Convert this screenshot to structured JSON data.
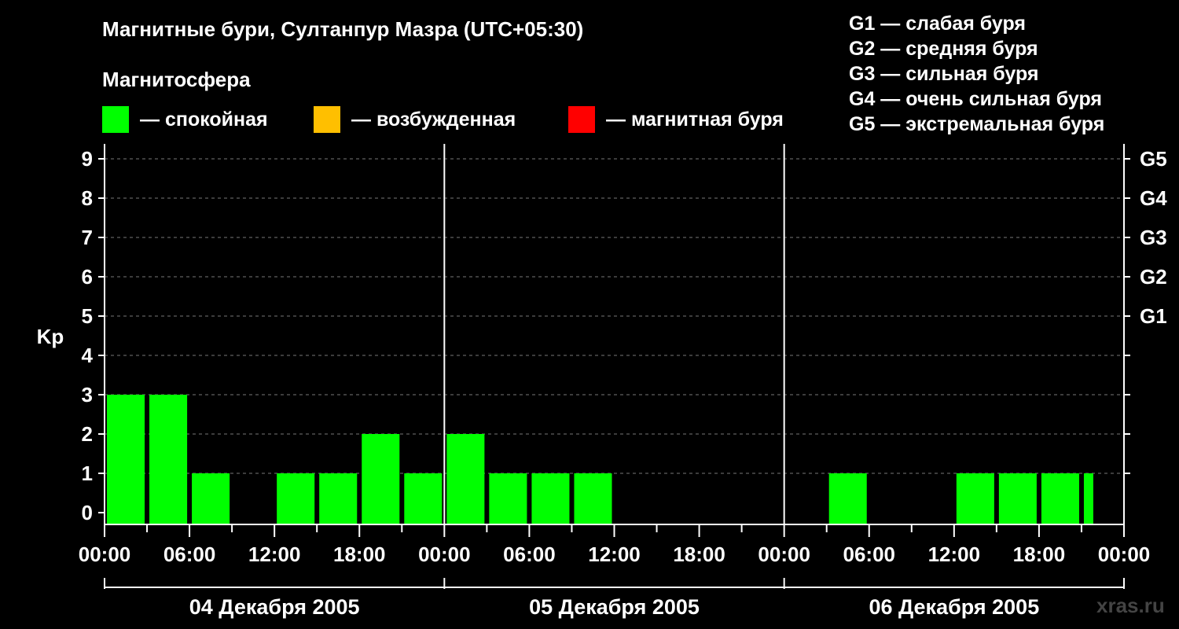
{
  "title": "Магнитные бури, Султанпур Мазра (UTC+05:30)",
  "subtitle": "Магнитосфера",
  "legend": [
    {
      "label": "— спокойная",
      "color": "#00ff00"
    },
    {
      "label": "— возбужденная",
      "color": "#ffbf00"
    },
    {
      "label": "— магнитная буря",
      "color": "#ff0000"
    }
  ],
  "g_scale": [
    "G1 — слабая буря",
    "G2 — средняя буря",
    "G3 — сильная буря",
    "G4 — очень сильная буря",
    "G5 — экстремальная буря"
  ],
  "watermark": "xras.ru",
  "chart_data": {
    "type": "bar",
    "ylabel": "Kp",
    "ylim": [
      0,
      9
    ],
    "y_ticks": [
      "0",
      "1",
      "2",
      "3",
      "4",
      "5",
      "6",
      "7",
      "8",
      "9"
    ],
    "right_ticks": [
      {
        "kp": 5,
        "label": "G1"
      },
      {
        "kp": 6,
        "label": "G2"
      },
      {
        "kp": 7,
        "label": "G3"
      },
      {
        "kp": 8,
        "label": "G4"
      },
      {
        "kp": 9,
        "label": "G5"
      }
    ],
    "x_tick_labels": [
      "00:00",
      "06:00",
      "12:00",
      "18:00",
      "00:00",
      "06:00",
      "12:00",
      "18:00",
      "00:00",
      "06:00",
      "12:00",
      "18:00",
      "00:00"
    ],
    "days": [
      "04 Декабря 2005",
      "05 Декабря 2005",
      "06 Декабря 2005"
    ],
    "grid": true,
    "series": [
      {
        "values": [
          3,
          3,
          1,
          0,
          1,
          1,
          2,
          1,
          2,
          1,
          1,
          1,
          0,
          0,
          0,
          0,
          0,
          1,
          0,
          0,
          1,
          1,
          1,
          1
        ],
        "colors": [
          "#00ff00",
          "#00ff00",
          "#00ff00",
          "#00ff00",
          "#00ff00",
          "#00ff00",
          "#00ff00",
          "#00ff00",
          "#00ff00",
          "#00ff00",
          "#00ff00",
          "#00ff00",
          "#00ff00",
          "#00ff00",
          "#00ff00",
          "#00ff00",
          "#00ff00",
          "#00ff00",
          "#00ff00",
          "#00ff00",
          "#00ff00",
          "#00ff00",
          "#00ff00",
          "#00ff00"
        ]
      }
    ]
  }
}
